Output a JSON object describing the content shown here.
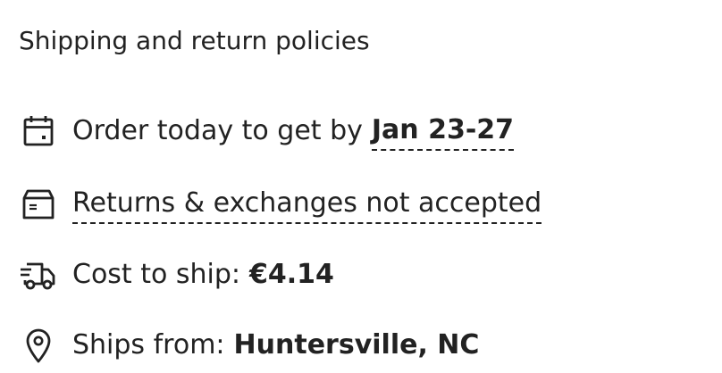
{
  "section": {
    "title": "Shipping and return policies",
    "rows": [
      {
        "icon": "calendar-icon",
        "prefix": "Order today to get by",
        "value": "Jan 23-27"
      },
      {
        "icon": "package-box-icon",
        "link": "Returns & exchanges not accepted"
      },
      {
        "icon": "delivery-truck-icon",
        "prefix": "Cost to ship:",
        "value": "€4.14"
      },
      {
        "icon": "location-pin-icon",
        "prefix": "Ships from:",
        "value": "Huntersville, NC"
      }
    ]
  },
  "colors": {
    "text": "#222222",
    "background": "#ffffff"
  }
}
